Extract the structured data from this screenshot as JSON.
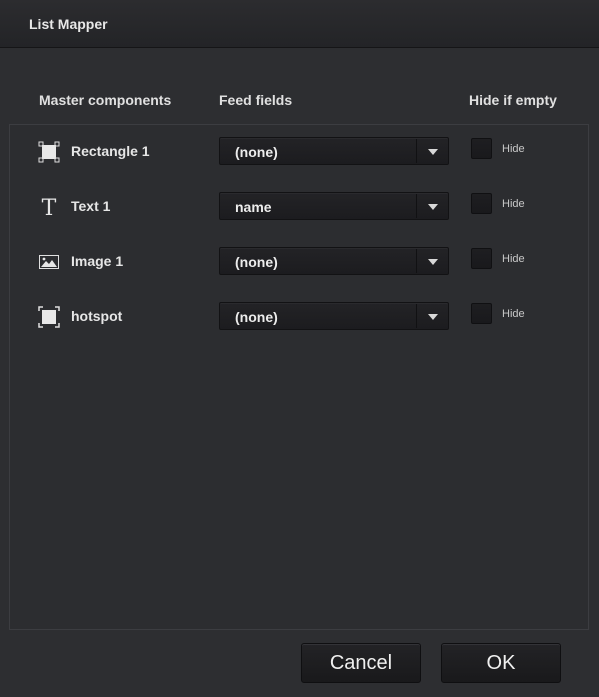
{
  "window": {
    "title": "List Mapper"
  },
  "columns": {
    "master": "Master components",
    "feed": "Feed fields",
    "hide": "Hide if empty"
  },
  "rows": [
    {
      "icon": "rectangle-icon",
      "label": "Rectangle 1",
      "feed_value": "(none)",
      "hide_label": "Hide",
      "hide_checked": false
    },
    {
      "icon": "text-icon",
      "label": "Text 1",
      "feed_value": "name",
      "hide_label": "Hide",
      "hide_checked": false
    },
    {
      "icon": "image-icon",
      "label": "Image 1",
      "feed_value": "(none)",
      "hide_label": "Hide",
      "hide_checked": false
    },
    {
      "icon": "hotspot-icon",
      "label": "hotspot",
      "feed_value": "(none)",
      "hide_label": "Hide",
      "hide_checked": false
    }
  ],
  "buttons": {
    "cancel": "Cancel",
    "ok": "OK"
  }
}
